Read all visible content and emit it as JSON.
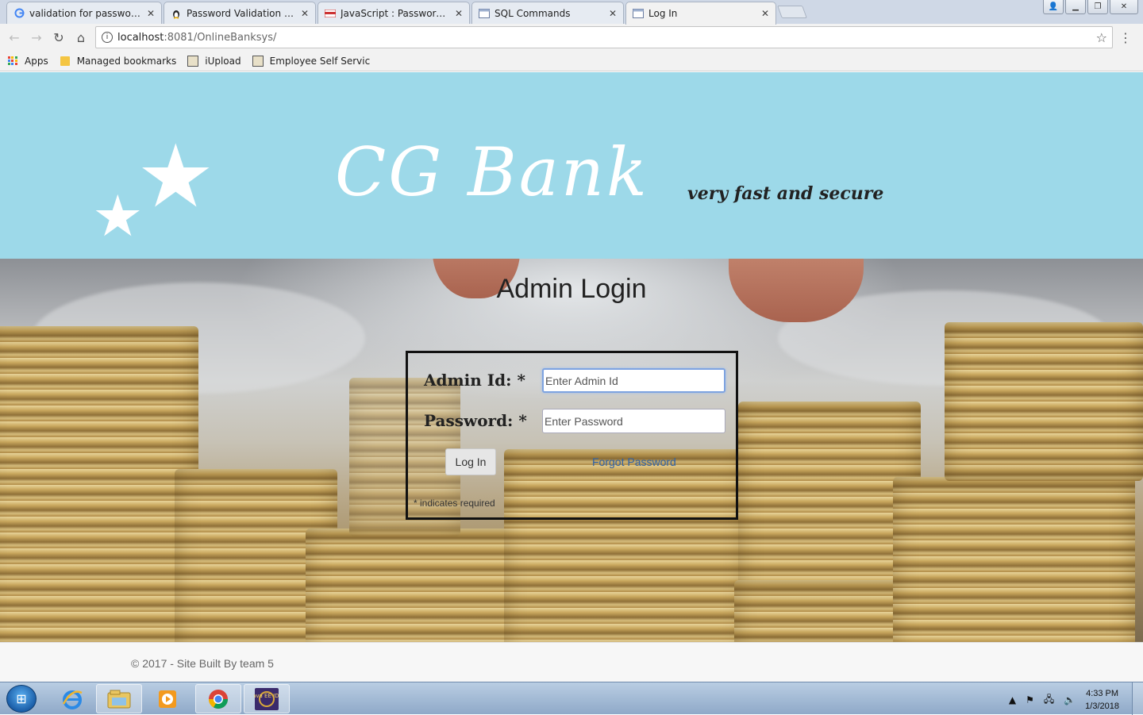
{
  "browser": {
    "tabs": [
      {
        "title": "validation for password -",
        "favicon": "google-icon",
        "active": false
      },
      {
        "title": "Password Validation usin",
        "favicon": "penguin-icon",
        "active": false
      },
      {
        "title": "JavaScript : Password val",
        "favicon": "w3resource-icon",
        "active": false
      },
      {
        "title": "SQL Commands",
        "favicon": "page-icon",
        "active": false
      },
      {
        "title": "Log In",
        "favicon": "page-icon",
        "active": true
      }
    ],
    "address": {
      "host": "localhost",
      "path": ":8081/OnlineBanksys/"
    },
    "bookmarks": [
      {
        "label": "Apps",
        "icon": "apps-grid-icon"
      },
      {
        "label": "Managed bookmarks",
        "icon": "folder-icon"
      },
      {
        "label": "iUpload",
        "icon": "page-icon"
      },
      {
        "label": "Employee Self Servic",
        "icon": "page-icon"
      }
    ]
  },
  "header": {
    "brand": "CG Bank",
    "tagline": "very fast and secure",
    "accent_color": "#9dd9e9"
  },
  "login": {
    "title": "Admin Login",
    "admin_id_label": "Admin Id:",
    "password_label": "Password:",
    "required_mark": "*",
    "admin_id_placeholder": "Enter Admin Id",
    "password_placeholder": "Enter Password",
    "login_button": "Log In",
    "forgot_link": "Forgot Password",
    "required_note": "* indicates required"
  },
  "footer": {
    "text": "© 2017 - Site Built By team 5"
  },
  "taskbar": {
    "time": "4:33 PM",
    "date": "1/3/2018",
    "pinned": [
      "internet-explorer-icon",
      "file-explorer-icon",
      "media-player-icon",
      "chrome-icon",
      "java-ee-ide-icon"
    ],
    "java_ide_label": "Java EE IDE"
  }
}
